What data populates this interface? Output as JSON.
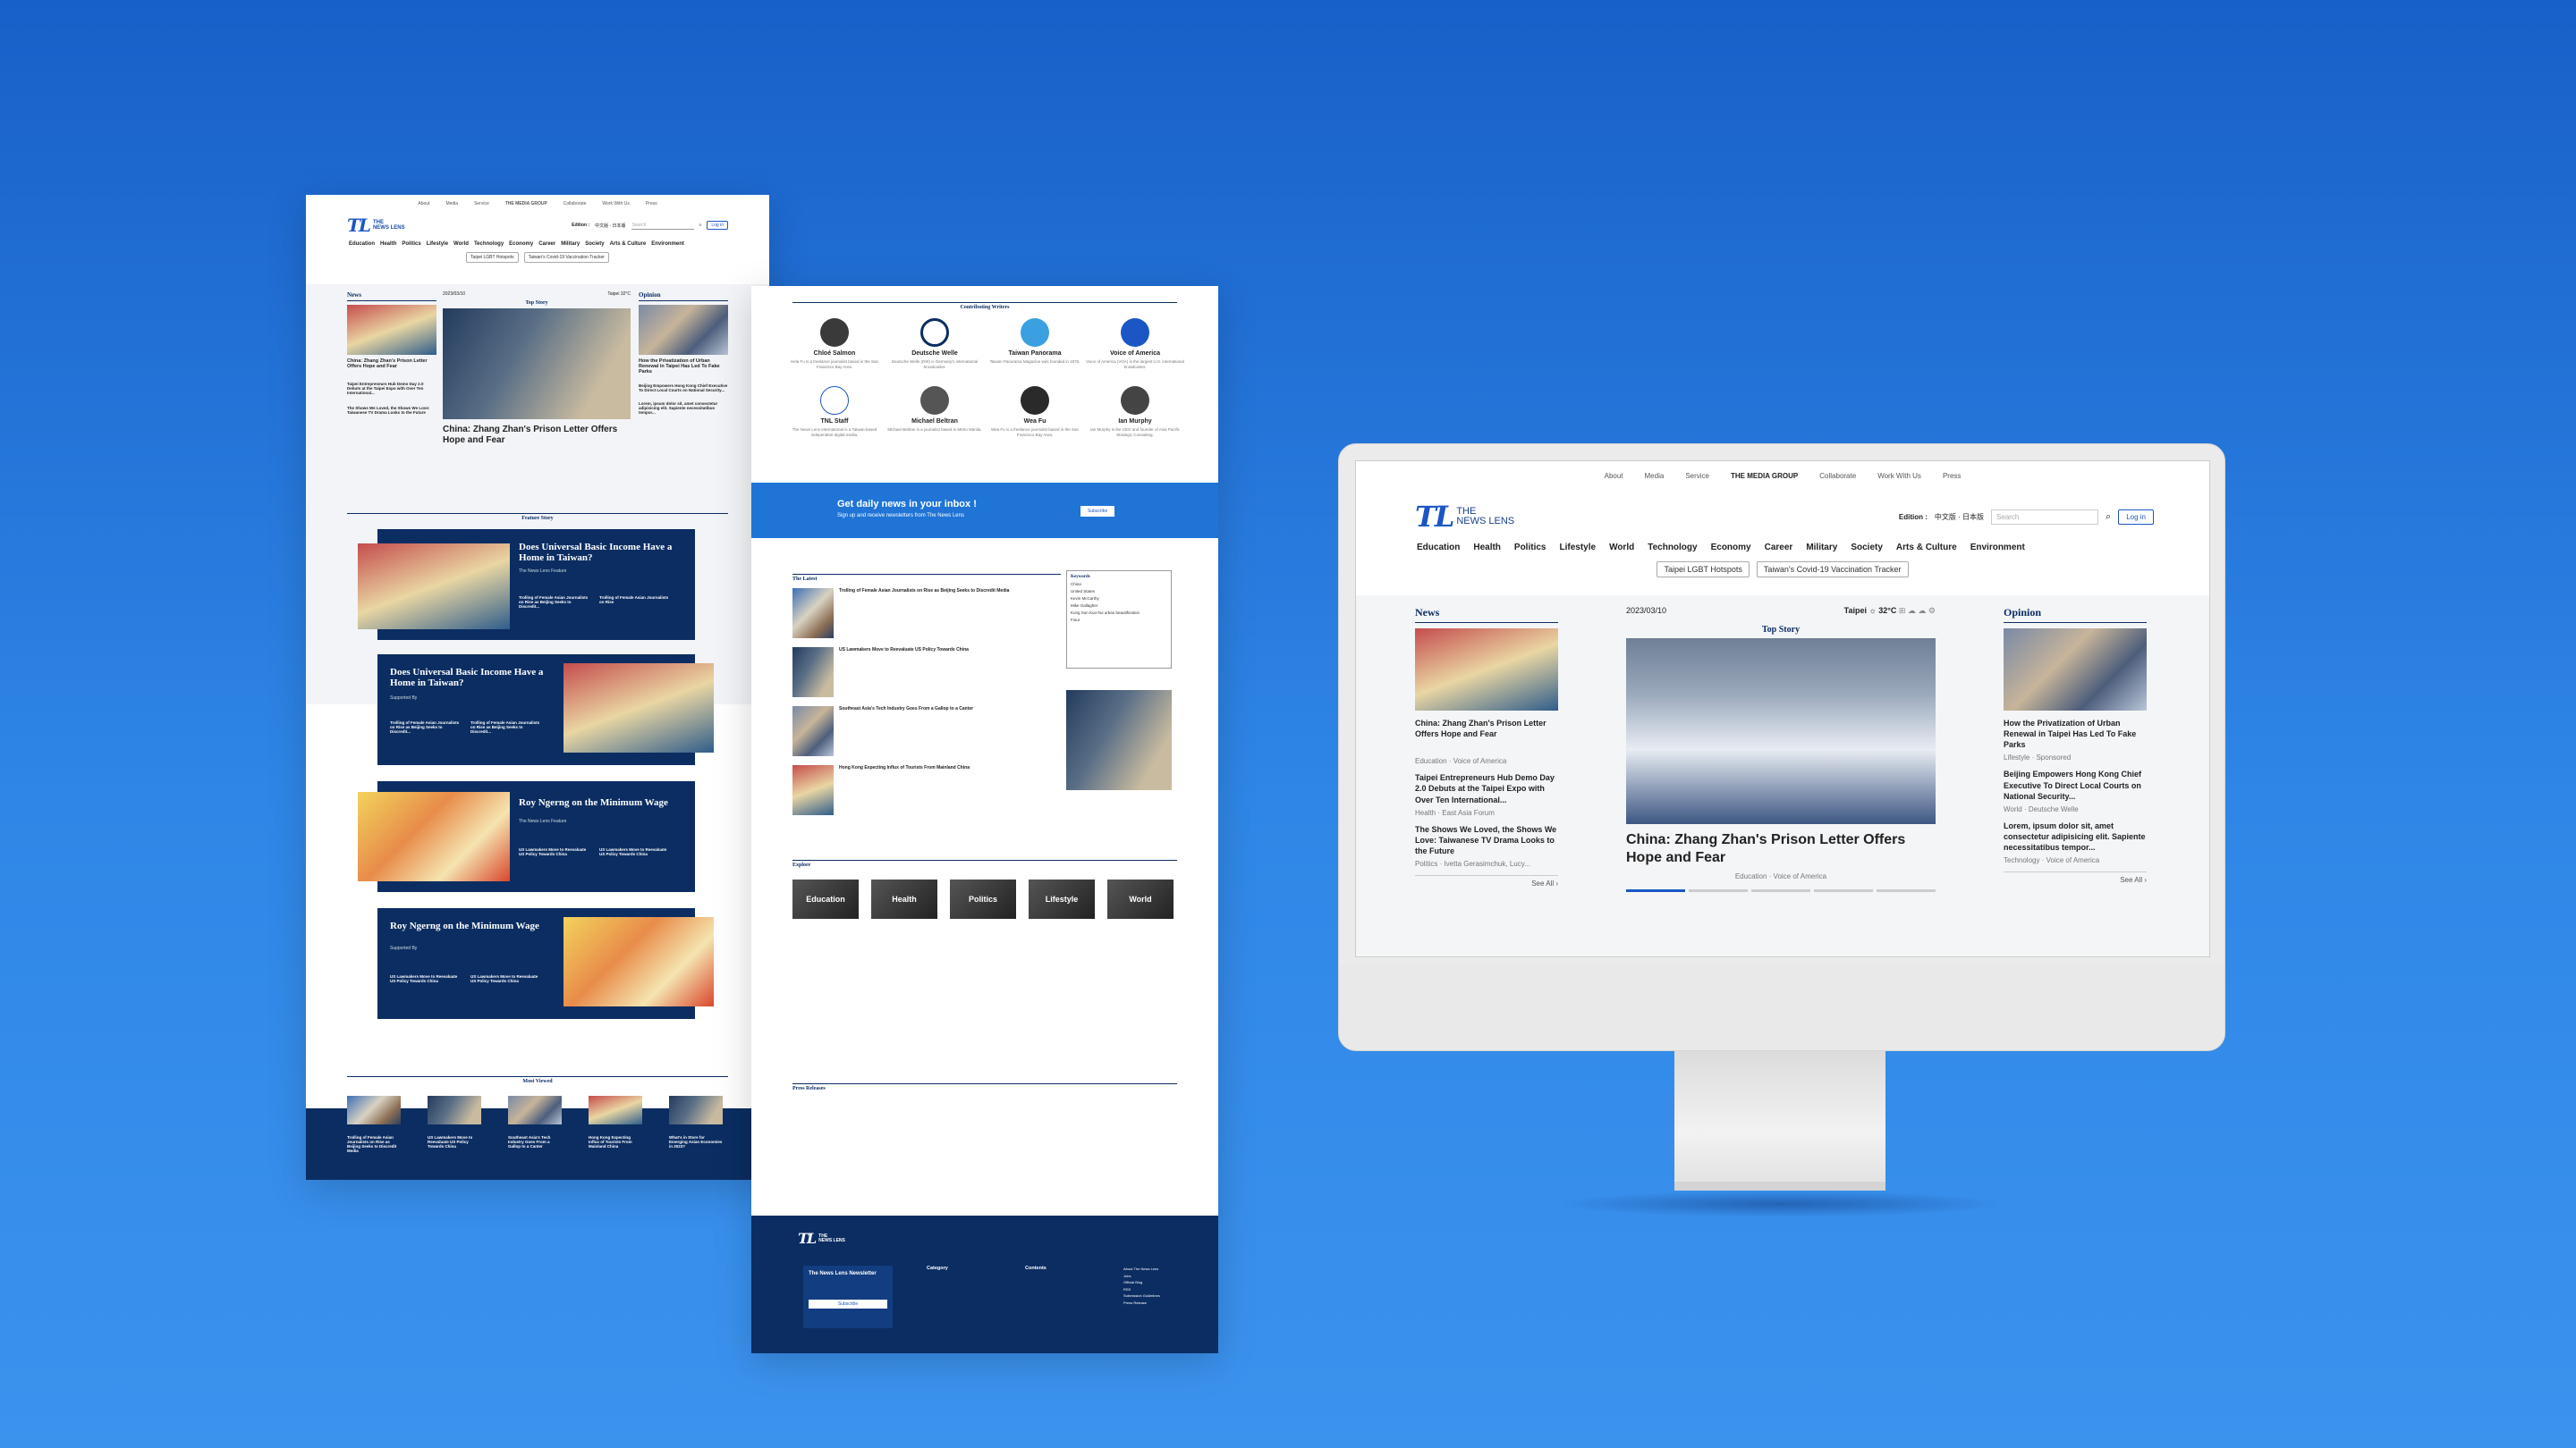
{
  "brand": {
    "mark": "TL",
    "line1": "THE",
    "line2": "NEWS LENS"
  },
  "utility_nav": [
    "About",
    "Media",
    "Service",
    "THE MEDIA GROUP",
    "Collaborate",
    "Work With Us",
    "Press"
  ],
  "edition": {
    "label": "Edition :",
    "options": "中文版 · 日本版"
  },
  "search_placeholder": "Search",
  "login_label": "Log in",
  "categories": [
    "Education",
    "Health",
    "Politics",
    "Lifestyle",
    "World",
    "Technology",
    "Economy",
    "Career",
    "Military",
    "Society",
    "Arts & Culture",
    "Environment"
  ],
  "pills": [
    "Taipei LGBT Hotspots",
    "Taiwan's Covid-19 Vaccination Tracker"
  ],
  "home": {
    "news_label": "News",
    "date": "2023/03/10",
    "weather": "Taipei",
    "temp": "32°C",
    "top_story_label": "Top Story",
    "opinion_label": "Opinion",
    "news_items": [
      {
        "title": "China: Zhang Zhan's Prison Letter Offers Hope and Fear",
        "tag1": "Education",
        "tag2": "Voice of America"
      },
      {
        "title": "Taipei Entrepreneurs Hub Demo Day 2.0 Debuts at the Taipei Expo with Over Ten International...",
        "tag1": "Health",
        "tag2": "East Asia Forum"
      },
      {
        "title": "The Shows We Loved, the Shows We Love: Taiwanese TV Drama Looks to the Future",
        "tag1": "Politics",
        "tag2": "Ivetta Gerasimchuk, Lucy..."
      }
    ],
    "top_story": {
      "title": "China: Zhang Zhan's Prison Letter Offers Hope and Fear",
      "tag1": "Education",
      "tag2": "Voice of America"
    },
    "opinion_items": [
      {
        "title": "How the Privatization of Urban Renewal in Taipei Has Led To Fake Parks",
        "tag1": "Lifestyle",
        "tag2": "Sponsored"
      },
      {
        "title": "Beijing Empowers Hong Kong Chief Executive To Direct Local Courts on National Security...",
        "tag1": "World",
        "tag2": "Deutsche Welle"
      },
      {
        "title": "Lorem, ipsum dolor sit, amet consectetur adipisicing elit. Sapiente necessitatibus tempor...",
        "tag1": "Technology",
        "tag2": "Voice of America"
      }
    ],
    "see_all": "See All"
  },
  "feature": {
    "label": "Feature Story",
    "cards": [
      {
        "title": "Does Universal Basic Income Have a Home in Taiwan?",
        "sub": "The News Lens Feature",
        "a": "Trolling of Female Asian Journalists on Rise as Beijing Seeks to Discredit...",
        "b": "Trolling of Female Asian Journalists on Rise"
      },
      {
        "title": "Does Universal Basic Income Have a Home in Taiwan?",
        "sub": "Supported By",
        "a": "Trolling of Female Asian Journalists on Rise as Beijing Seeks to Discredit...",
        "b": "Trolling of Female Asian Journalists on Rise as Beijing Seeks to Discredit..."
      },
      {
        "title": "Roy Ngerng on the Minimum Wage",
        "sub": "The News Lens Feature",
        "a": "US Lawmakers Move to Reevaluate US Policy Towards China",
        "b": "US Lawmakers Move to Reevaluate US Policy Towards China"
      },
      {
        "title": "Roy Ngerng on the Minimum Wage",
        "sub": "Supported By",
        "a": "US Lawmakers Move to Reevaluate US Policy Towards China",
        "b": "US Lawmakers Move to Reevaluate US Policy Towards China"
      }
    ]
  },
  "most_viewed": {
    "label": "Most Viewed",
    "items": [
      "Trolling of Female Asian Journalists on Rise as Beijing Seeks to Discredit Media",
      "US Lawmakers Move to Reevaluate US Policy Towards China",
      "Southeast Asia's Tech Industry Goes From a Gallop to a Canter",
      "Hong Kong Expecting Influx of Tourists From Mainland China",
      "What's in Store for Emerging Asian Economies in 2023?"
    ]
  },
  "writers": {
    "label": "Contributing Writers",
    "items": [
      {
        "name": "Chloé Salmon",
        "desc": "Hela Fu is a freelance journalist based in the San Francisco Bay Area."
      },
      {
        "name": "Deutsche Welle",
        "desc": "Deutsche Welle (DW) is Germany's international broadcaster."
      },
      {
        "name": "Taiwan Panorama",
        "desc": "Taiwan Panorama Magazine was founded in 1976."
      },
      {
        "name": "Voice of America",
        "desc": "Voice of America (VOA) is the largest U.S. international broadcaster."
      },
      {
        "name": "TNL Staff",
        "desc": "The News Lens International is a Taiwan-based independent digital media."
      },
      {
        "name": "Michael Beltran",
        "desc": "Michael Beltran is a journalist based in Metro Manila."
      },
      {
        "name": "Wea Fu",
        "desc": "Wea Fu is a freelance journalist based in the San Francisco Bay Area."
      },
      {
        "name": "Ian Murphy",
        "desc": "Ian Murphy is the CEO and founder of Asia Pacific Strategic Consulting."
      }
    ]
  },
  "newsletter": {
    "title": "Get daily news in your inbox !",
    "sub": "Sign up and receive newsletters from The News Lens",
    "button": "Subscribe"
  },
  "latest": {
    "label": "The Latest",
    "items": [
      {
        "title": "Trolling of Female Asian Journalists on Rise as Beijing Seeks to Discredit Media",
        "tag1": "Education",
        "tag2": "Sponsored"
      },
      {
        "title": "US Lawmakers Move to Reevaluate US Policy Towards China",
        "tag1": "Health",
        "tag2": "East Asia Forum"
      },
      {
        "title": "Southeast Asia's Tech Industry Goes From a Gallop to a Canter",
        "tag1": "Politics",
        "tag2": "Nonnewship"
      },
      {
        "title": "Hong Kong Expecting Influx of Tourists From Mainland China",
        "tag1": "World",
        "tag2": "Voice of America"
      }
    ],
    "keywords_label": "Keywords",
    "keywords": [
      "China",
      "United States",
      "Kevin McCarthy",
      "Mike Gallagher",
      "Kung Sun Kuo-hui urban beautification",
      "Fiour"
    ]
  },
  "explore": {
    "label": "Explore",
    "tiles": [
      "Education",
      "Health",
      "Politics",
      "Lifestyle",
      "World"
    ]
  },
  "press": {
    "label": "Press Releases"
  },
  "footer": {
    "newsletter_title": "The News Lens Newsletter",
    "subscribe": "Subscribe",
    "category_label": "Category",
    "contents_label": "Contents",
    "links": [
      "About The News Lens",
      "Jobs",
      "Official Blog",
      "RSS",
      "Submission Guidelines",
      "Press Release"
    ]
  },
  "colors": {
    "navy": "#0b2d62",
    "blue": "#1b56c4",
    "bg_top": "#1860c9",
    "bg_bottom": "#3c93ee"
  }
}
